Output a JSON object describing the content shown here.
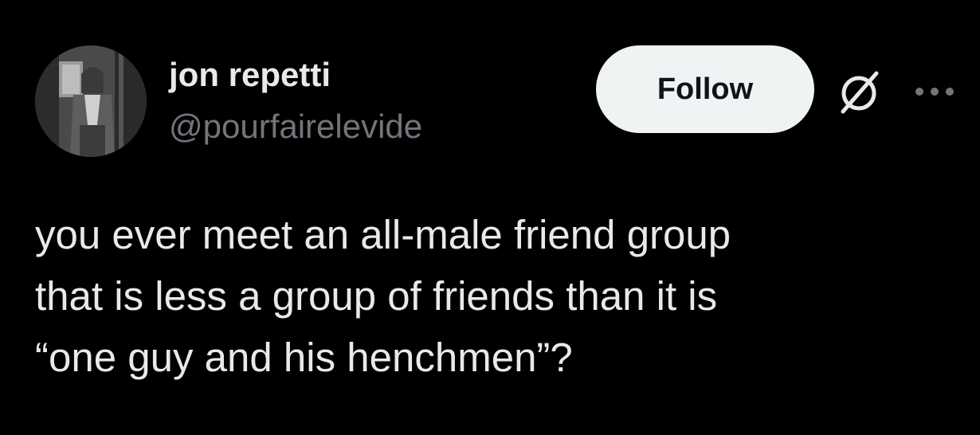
{
  "author": {
    "display_name": "jon repetti",
    "handle": "@pourfairelevide",
    "avatar_icon": "profile-photo"
  },
  "actions": {
    "follow_label": "Follow",
    "grok_icon": "grok-icon",
    "more_icon": "more-icon"
  },
  "tweet": {
    "lines": [
      "you ever meet an all-male friend group",
      "that is less a group of friends than it is",
      "“one guy and his henchmen”?"
    ]
  },
  "colors": {
    "background": "#000000",
    "text_primary": "#e7e9ea",
    "text_secondary": "#71767b",
    "follow_bg": "#eff3f4",
    "follow_text": "#0f1419"
  }
}
